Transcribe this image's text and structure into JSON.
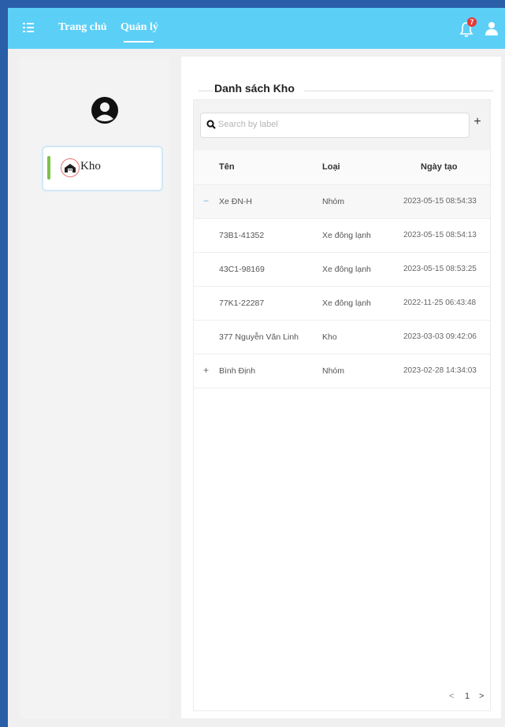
{
  "header": {
    "nav": [
      "Trang chủ",
      "Quản lý"
    ],
    "notification_count": "7"
  },
  "sidebar": {
    "item_label": "Kho"
  },
  "main": {
    "title": "Danh sách Kho",
    "search_placeholder": "Search by label",
    "columns": [
      "Tên",
      "Loại",
      "Ngày tạo"
    ],
    "rows": [
      {
        "name": "Xe ĐN-H",
        "type": "Nhóm",
        "date": "2023-05-15 08:54:33",
        "expand": "−"
      },
      {
        "name": "73B1-41352",
        "type": "Xe đông lạnh",
        "date": "2023-05-15 08:54:13"
      },
      {
        "name": "43C1-98169",
        "type": "Xe đông lạnh",
        "date": "2023-05-15 08:53:25"
      },
      {
        "name": "77K1-22287",
        "type": "Xe đông lạnh",
        "date": "2022-11-25 06:43:48"
      },
      {
        "name": "377 Nguyễn Văn Linh",
        "type": "Kho",
        "date": "2023-03-03 09:42:06"
      },
      {
        "name": "Bình Định",
        "type": "Nhóm",
        "date": "2023-02-28 14:34:03",
        "expand": "+"
      }
    ],
    "pagination": {
      "prev": "<",
      "page": "1",
      "next": ">"
    }
  },
  "colors": {
    "topbar": "#5ccff6",
    "accent_bar": "#7cc24a",
    "badge": "#e53935"
  },
  "icons": [
    "menu-icon",
    "bell-icon",
    "user-icon",
    "avatar-icon",
    "warehouse-icon",
    "search-icon",
    "plus-icon"
  ]
}
